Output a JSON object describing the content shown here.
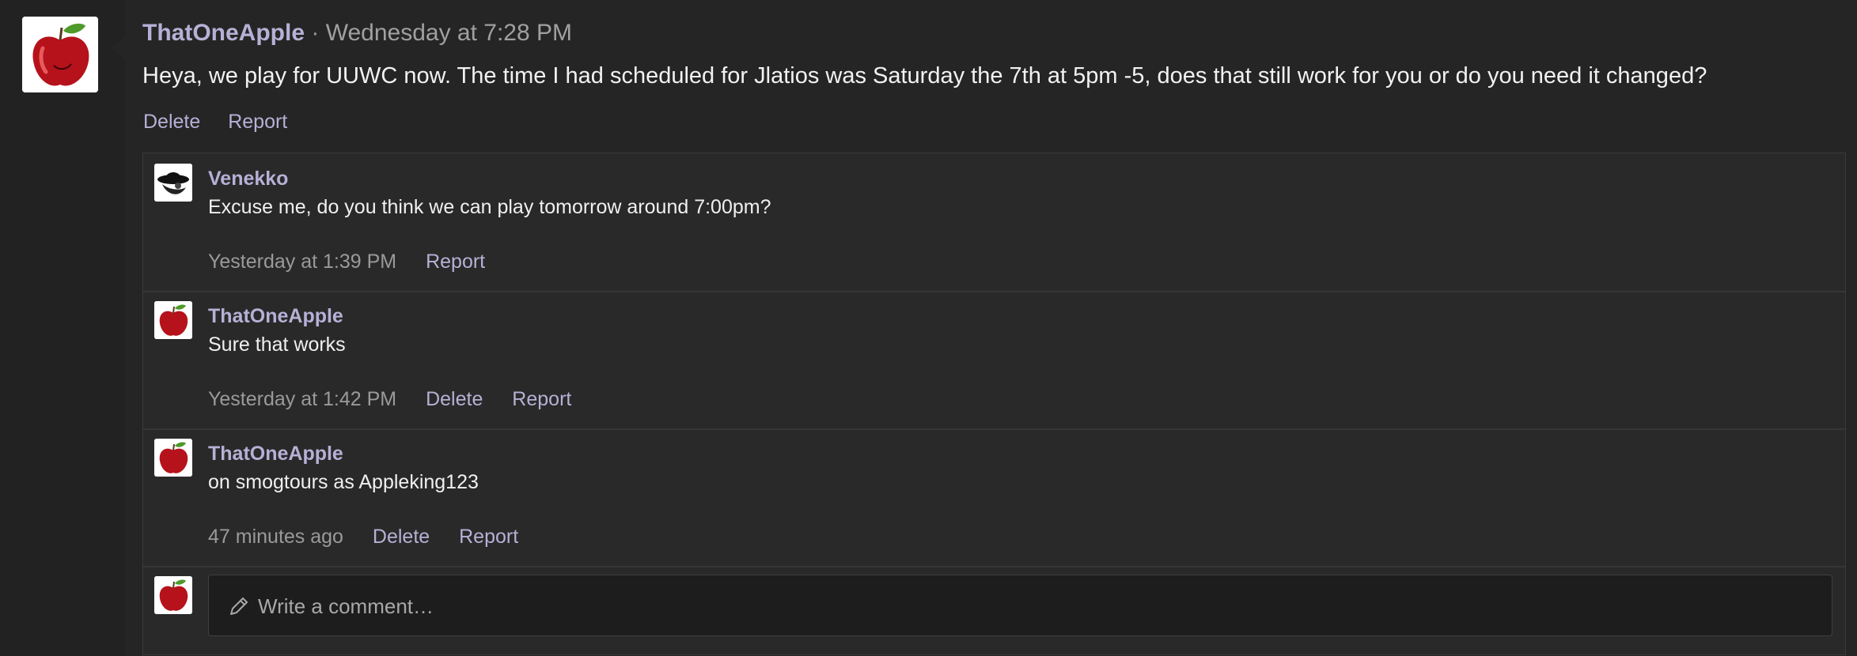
{
  "post": {
    "author": "ThatOneApple",
    "separator": "·",
    "time": "Wednesday at 7:28 PM",
    "body": "Heya, we play for UUWC now. The time I had scheduled for Jlatios was Saturday the 7th at 5pm -5, does that still work for you or do you need it changed?",
    "actions": {
      "delete": "Delete",
      "report": "Report"
    }
  },
  "comments": [
    {
      "author": "Venekko",
      "text": "Excuse me, do you think we can play tomorrow around 7:00pm?",
      "time": "Yesterday at 1:39 PM",
      "report": "Report",
      "avatar_icon": "hat-figure-avatar"
    },
    {
      "author": "ThatOneApple",
      "text": "Sure that works",
      "time": "Yesterday at 1:42 PM",
      "delete": "Delete",
      "report": "Report",
      "avatar_icon": "red-apple-avatar"
    },
    {
      "author": "ThatOneApple",
      "text": "on smogtours as Appleking123",
      "time": "47 minutes ago",
      "delete": "Delete",
      "report": "Report",
      "avatar_icon": "red-apple-avatar"
    }
  ],
  "composer": {
    "placeholder": "Write a comment…",
    "icon": "pencil-icon"
  },
  "colors": {
    "link": "#b7b0d6",
    "background": "#252525",
    "text": "#f2f2f2",
    "muted": "#9a9a9a"
  }
}
